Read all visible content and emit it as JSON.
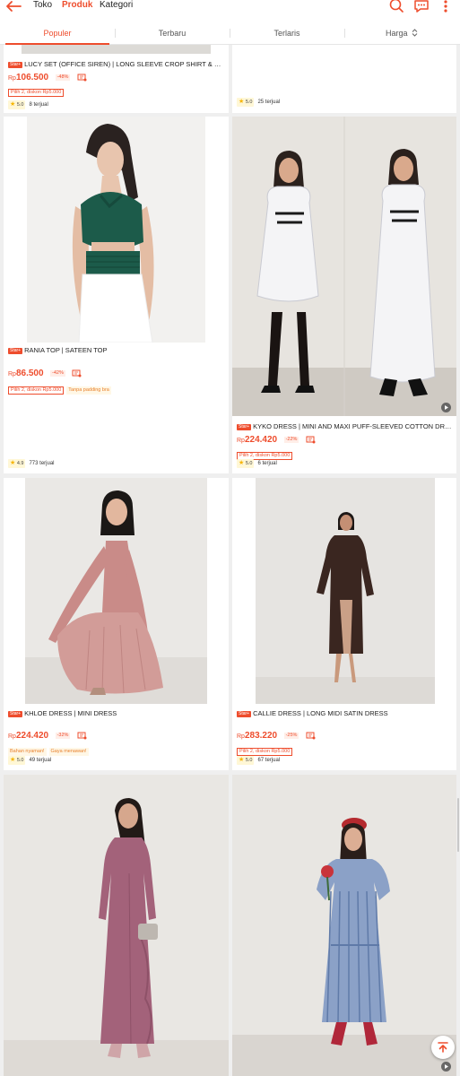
{
  "header": {
    "tabs": [
      {
        "label": "Toko"
      },
      {
        "label": "Produk"
      },
      {
        "label": "Kategori"
      }
    ],
    "icons": [
      "back-arrow-icon",
      "search-icon",
      "chat-icon",
      "more-vertical-icon"
    ],
    "accent_color": "#ee4d2d"
  },
  "sort": {
    "items": [
      {
        "label": "Populer"
      },
      {
        "label": "Terbaru"
      },
      {
        "label": "Terlaris"
      },
      {
        "label": "Harga",
        "icon": "sort-updown-icon"
      }
    ],
    "active": "Populer"
  },
  "products": [
    {
      "badge": "Star+",
      "name": "LUCY SET (OFFICE SIREN) | LONG SLEEVE CROP SHIRT & BUT...",
      "currency": "Rp",
      "price": "106.500",
      "discount": "-48%",
      "promos": [
        "Pilih 2, diskon Rp5.000"
      ],
      "rating": "5.0",
      "sold": "8 terjual"
    },
    {
      "badge": "",
      "name": "",
      "currency": "",
      "price": "",
      "discount": "",
      "promos": [],
      "rating": "5.0",
      "sold": "25 terjual"
    },
    {
      "badge": "Star+",
      "name": "RANIA TOP | SATEEN TOP",
      "currency": "Rp",
      "price": "86.500",
      "discount": "-42%",
      "promos": [
        "Pilih 2, diskon Rp5.000",
        "Tanpa padding bra"
      ],
      "rating": "4.9",
      "sold": "773 terjual"
    },
    {
      "badge": "Star+",
      "name": "KYKO DRESS | MINI AND MAXI PUFF-SLEEVED COTTON DRESS",
      "currency": "Rp",
      "price": "224.420",
      "discount": "-22%",
      "promos": [
        "Pilih 2, diskon Rp5.000"
      ],
      "rating": "5.0",
      "sold": "6 terjual"
    },
    {
      "badge": "Star+",
      "name": "KHLOE DRESS | MINI DRESS",
      "currency": "Rp",
      "price": "224.420",
      "discount": "-32%",
      "promos": [
        "Bahan nyaman!",
        "Gaya menawan!"
      ],
      "rating": "5.0",
      "sold": "49 terjual"
    },
    {
      "badge": "Star+",
      "name": "CALLIE DRESS | LONG MIDI SATIN DRESS",
      "currency": "Rp",
      "price": "283.220",
      "discount": "-25%",
      "promos": [
        "Pilih 2, diskon Rp5.000"
      ],
      "rating": "5.0",
      "sold": "67 terjual"
    }
  ],
  "floating": {
    "scroll_top_icon": "arrow-up-to-top-icon"
  }
}
